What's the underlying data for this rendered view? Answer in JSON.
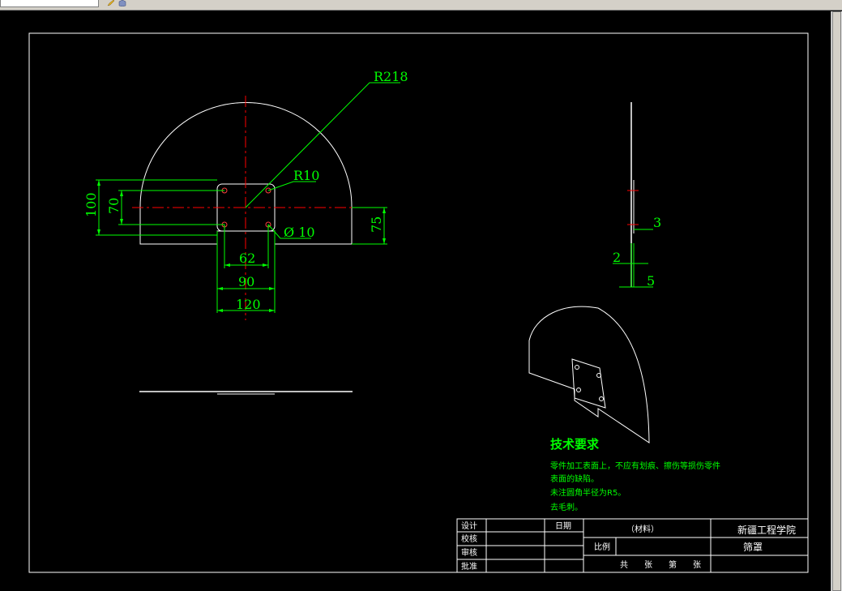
{
  "colors": {
    "background": "#000000",
    "geometry": "#ffffff",
    "dimension": "#00ff00",
    "centerline": "#ff0000",
    "text": "#00ff00",
    "frame": "#ffffff"
  },
  "icons": [
    "pencil-icon",
    "cube-icon"
  ],
  "dimensions": {
    "r218": "R218",
    "r10": "R10",
    "hole": "Ø 10",
    "h100": "100",
    "h70": "70",
    "h75": "75",
    "w62": "62",
    "w90": "90",
    "w120": "120",
    "side3": "3",
    "side2": "2",
    "side5": "5"
  },
  "tech": {
    "title": "技术要求",
    "lines": [
      "零件加工表面上，不应有划痕、擦伤等损伤零件",
      "表面的缺陷。",
      "未注圆角半径为R5。",
      "去毛刺。"
    ]
  },
  "title_block": {
    "design": "设计",
    "proof": "校核",
    "review": "审核",
    "approve": "批准",
    "date": "日期",
    "material": "（材料）",
    "scale": "比例",
    "school": "新疆工程学院",
    "part_name": "筛罩",
    "sheets": "共　　张　　第　　张"
  }
}
